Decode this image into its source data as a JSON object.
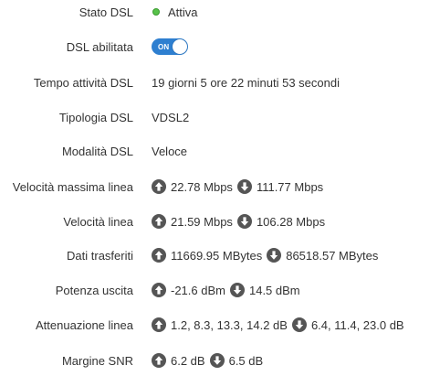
{
  "colors": {
    "status_ok": "#57c24a",
    "toggle_on": "#2e7fd0",
    "arrow_icon": "#555555",
    "text": "#333333"
  },
  "rows": {
    "stato": {
      "label": "Stato DSL",
      "value": "Attiva",
      "icon": "green-dot-icon"
    },
    "abilitata": {
      "label": "DSL abilitata",
      "toggle_label": "ON"
    },
    "tempo": {
      "label": "Tempo attività DSL",
      "value": "19 giorni 5 ore 22 minuti 53 secondi"
    },
    "tipologia": {
      "label": "Tipologia DSL",
      "value": "VDSL2"
    },
    "modalita": {
      "label": "Modalità DSL",
      "value": "Veloce"
    },
    "velocita_massima": {
      "label": "Velocità massima linea",
      "up": "22.78 Mbps",
      "down": "111.77 Mbps"
    },
    "velocita": {
      "label": "Velocità linea",
      "up": "21.59 Mbps",
      "down": "106.28 Mbps"
    },
    "dati": {
      "label": "Dati trasferiti",
      "up": "11669.95 MBytes",
      "down": "86518.57 MBytes"
    },
    "potenza": {
      "label": "Potenza uscita",
      "up": "-21.6 dBm",
      "down": "14.5 dBm"
    },
    "attenuazione": {
      "label": "Attenuazione linea",
      "up": "1.2, 8.3, 13.3, 14.2 dB",
      "down": "6.4, 11.4, 23.0 dB"
    },
    "snr": {
      "label": "Margine SNR",
      "up": "6.2 dB",
      "down": "6.5 dB"
    }
  }
}
